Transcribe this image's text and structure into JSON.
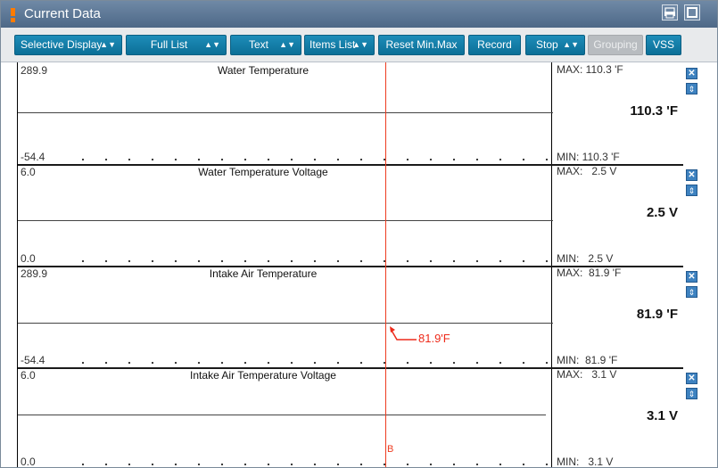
{
  "window": {
    "title": "Current Data"
  },
  "toolbar": {
    "selective_display": "Selective Display",
    "full_list": "Full List",
    "text": "Text",
    "items_list": "Items List",
    "reset_min_max": "Reset Min.Max",
    "record": "Record",
    "stop": "Stop",
    "grouping": "Grouping",
    "vss": "VSS"
  },
  "panels": [
    {
      "title": "Water Temperature",
      "axis_max": "289.9",
      "axis_min": "-54.4",
      "max": "MAX: 110.3 'F",
      "current": "110.3 'F",
      "min": "MIN: 110.3 'F",
      "reading": 110.3
    },
    {
      "title": "Water Temperature Voltage",
      "axis_max": "6.0",
      "axis_min": "0.0",
      "max": "MAX:   2.5 V",
      "current": "2.5 V",
      "min": "MIN:   2.5 V",
      "reading": 2.5
    },
    {
      "title": "Intake Air Temperature",
      "axis_max": "289.9",
      "axis_min": "-54.4",
      "max": "MAX:  81.9 'F",
      "current": "81.9 'F",
      "min": "MIN:  81.9 'F",
      "reading": 81.9
    },
    {
      "title": "Intake Air Temperature Voltage",
      "axis_max": "6.0",
      "axis_min": "0.0",
      "max": "MAX:   3.1 V",
      "current": "3.1 V",
      "min": "MIN:   3.1 V",
      "reading": 3.1
    }
  ],
  "cursor": {
    "label": "B",
    "marker_value": "81.9'F"
  },
  "colors": {
    "title_bar": "#5b7594",
    "button": "#137fab",
    "cursor": "#ee3b1f"
  }
}
